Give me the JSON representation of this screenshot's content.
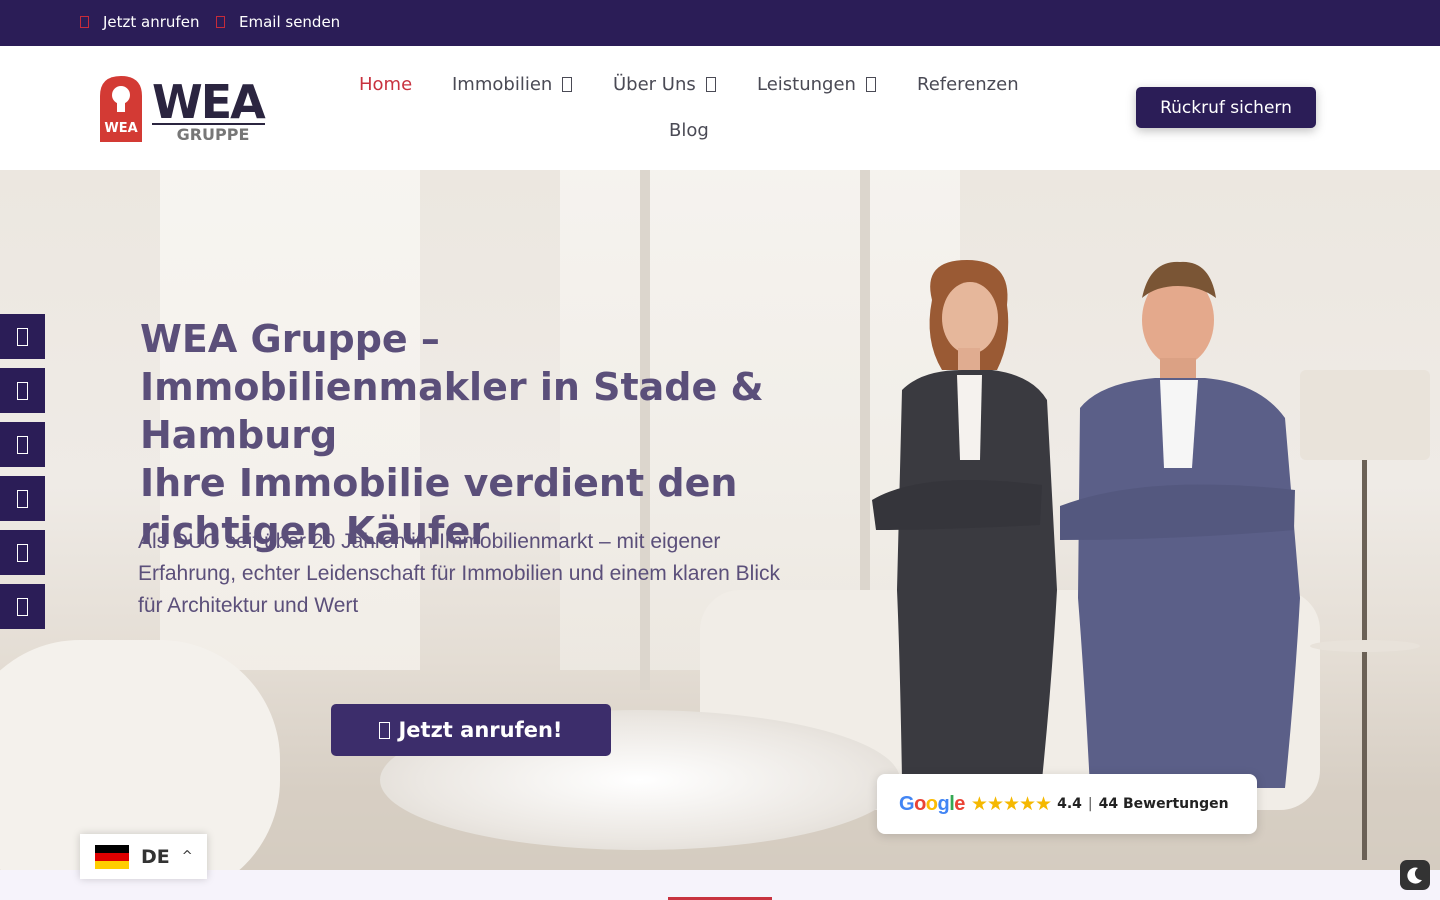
{
  "topbar": {
    "call_label": "Jetzt anrufen",
    "mail_label": "Email senden"
  },
  "logo": {
    "mark_text": "WEA",
    "word_main": "WEA",
    "word_sub": "GRUPPE"
  },
  "nav": {
    "items": [
      {
        "label": "Home",
        "has_dropdown": false,
        "active": true
      },
      {
        "label": "Immobilien",
        "has_dropdown": true,
        "active": false
      },
      {
        "label": "Über Uns",
        "has_dropdown": true,
        "active": false
      },
      {
        "label": "Leistungen",
        "has_dropdown": true,
        "active": false
      },
      {
        "label": "Referenzen",
        "has_dropdown": false,
        "active": false
      },
      {
        "label": "Blog",
        "has_dropdown": false,
        "active": false
      }
    ],
    "cta_label": "Rückruf sichern"
  },
  "hero": {
    "title_lines": [
      "WEA Gruppe –",
      "Immobilienmakler in Stade &",
      "Hamburg",
      "Ihre Immobilie verdient den",
      "richtigen Käufer"
    ],
    "subtitle": "Als DUO seit über 20 Jahren im Immobilienmarkt – mit eigener Erfahrung, echter Leidenschaft für Immobilien und einem klaren Blick für Architektur und Wert",
    "cta_label": "Jetzt anrufen!"
  },
  "social_buttons": [
    {
      "icon": "facebook-icon"
    },
    {
      "icon": "instagram-icon"
    },
    {
      "icon": "linkedin-icon"
    },
    {
      "icon": "xing-icon"
    },
    {
      "icon": "youtube-icon"
    },
    {
      "icon": "whatsapp-icon"
    }
  ],
  "rating": {
    "provider": "Google",
    "score": "4.4",
    "separator": "|",
    "count_label": "44 Bewertungen",
    "stars_filled": 4.4,
    "stars_total": 5
  },
  "language": {
    "code": "DE",
    "flag": "germany-flag"
  },
  "colors": {
    "brand_dark": "#2b1d57",
    "brand_red": "#c8323f",
    "hero_text": "#5b4f7a",
    "star": "#f5b800"
  }
}
